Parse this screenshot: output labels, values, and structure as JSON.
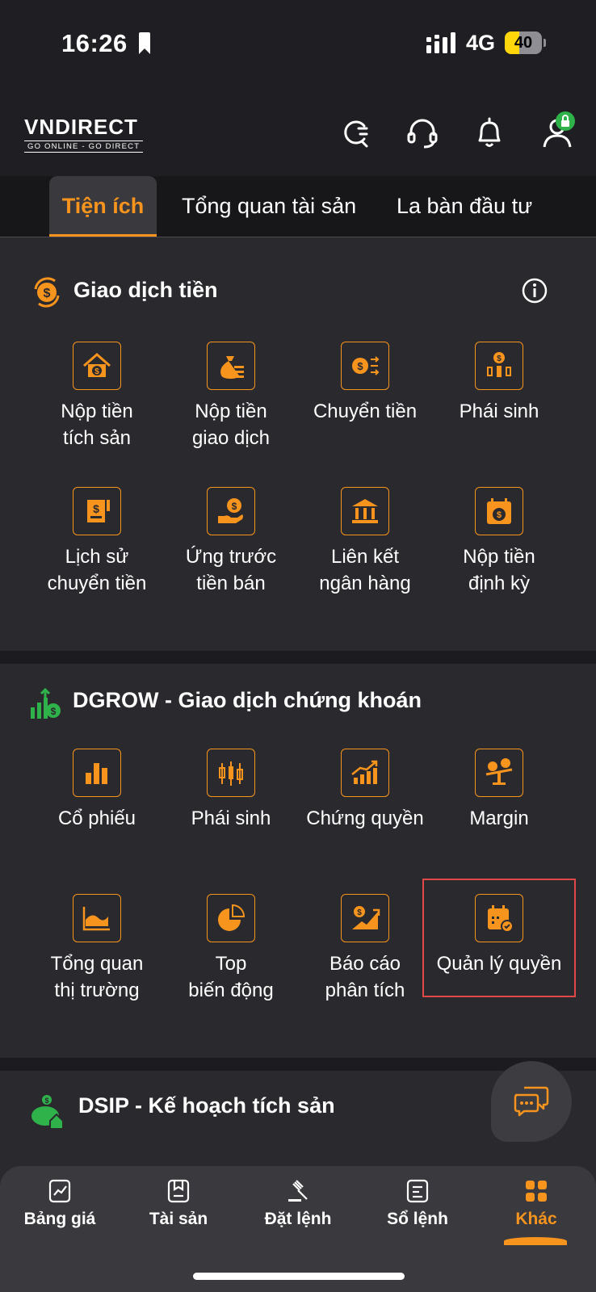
{
  "status_bar": {
    "time": "16:26",
    "network": "4G",
    "battery": "40"
  },
  "header": {
    "brand": "VNDIRECT",
    "tagline": "GO ONLINE - GO DIRECT"
  },
  "tabs": [
    {
      "label": "Tiện ích"
    },
    {
      "label": "Tổng quan tài sản"
    },
    {
      "label": "La bàn đầu tư"
    }
  ],
  "sections": {
    "cash": {
      "title": "Giao dịch tiền",
      "items": [
        {
          "label": "Nộp tiền\ntích sản"
        },
        {
          "label": "Nộp tiền\ngiao dịch"
        },
        {
          "label": "Chuyển tiền"
        },
        {
          "label": "Phái sinh"
        },
        {
          "label": "Lịch sử\nchuyển tiền"
        },
        {
          "label": "Ứng trước\ntiền bán"
        },
        {
          "label": "Liên kết\nngân hàng"
        },
        {
          "label": "Nộp tiền\nđịnh kỳ"
        }
      ]
    },
    "dgrow": {
      "title": "DGROW - Giao dịch chứng khoán",
      "items": [
        {
          "label": "Cổ phiếu"
        },
        {
          "label": "Phái sinh"
        },
        {
          "label": "Chứng quyền"
        },
        {
          "label": "Margin"
        },
        {
          "label": "Tổng quan\nthị trường"
        },
        {
          "label": "Top\nbiến động"
        },
        {
          "label": "Báo cáo\nphân tích"
        },
        {
          "label": "Quản lý quyền"
        }
      ]
    },
    "dsip": {
      "title": "DSIP - Kế hoạch tích sản"
    }
  },
  "bottom_nav": [
    {
      "label": "Bảng giá"
    },
    {
      "label": "Tài sản"
    },
    {
      "label": "Đặt lệnh"
    },
    {
      "label": "Sổ lệnh"
    },
    {
      "label": "Khác"
    }
  ],
  "colors": {
    "accent": "#f7941d",
    "background": "#2a292e",
    "highlight": "#e24848"
  }
}
